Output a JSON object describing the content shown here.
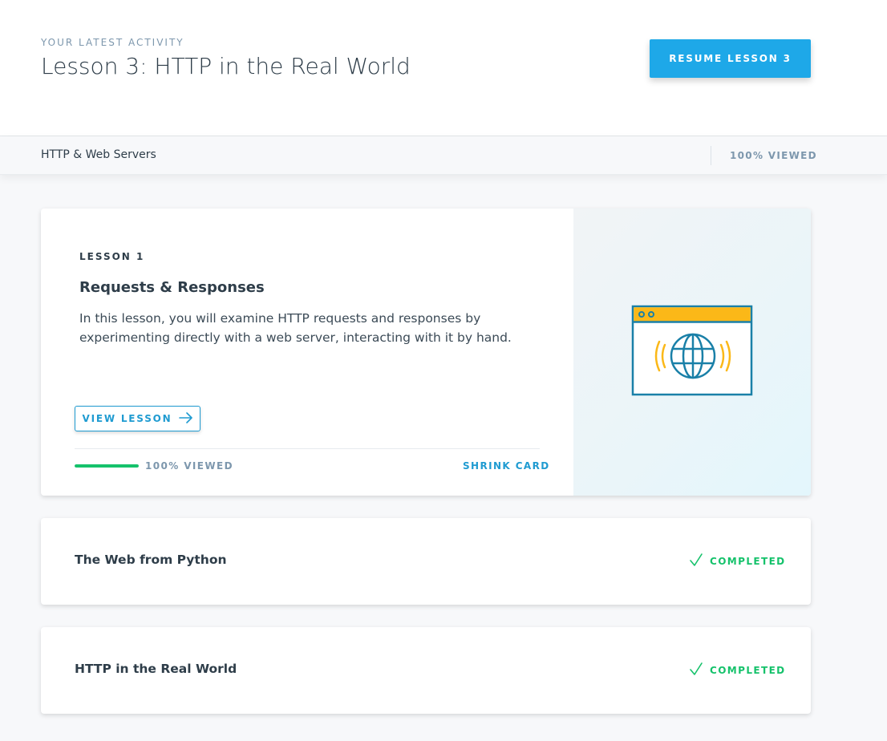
{
  "header": {
    "eyebrow": "YOUR LATEST ACTIVITY",
    "title": "Lesson 3: HTTP in the Real World",
    "resume_label": "RESUME LESSON 3"
  },
  "subbar": {
    "course_name": "HTTP & Web Servers",
    "viewed_label": "100% VIEWED"
  },
  "lesson_card": {
    "eyebrow": "LESSON 1",
    "title": "Requests & Responses",
    "description": "In this lesson, you will examine HTTP requests and responses by experimenting directly with a web server, interacting with it by hand.",
    "view_label": "VIEW LESSON",
    "progress_fraction": 1.0,
    "progress_label": "100% VIEWED",
    "shrink_label": "SHRINK CARD",
    "illustration_icon": "browser-globe-icon"
  },
  "completed_lessons": [
    {
      "title": "The Web from Python",
      "status": "COMPLETED"
    },
    {
      "title": "HTTP in the Real World",
      "status": "COMPLETED"
    }
  ],
  "colors": {
    "accent": "#1ea8e8",
    "link": "#1f9bd1",
    "success": "#15c26b",
    "muted": "#7d97ad",
    "text": "#2e3d49",
    "illustration_yellow": "#fbb818",
    "illustration_blue": "#1a80a8"
  }
}
